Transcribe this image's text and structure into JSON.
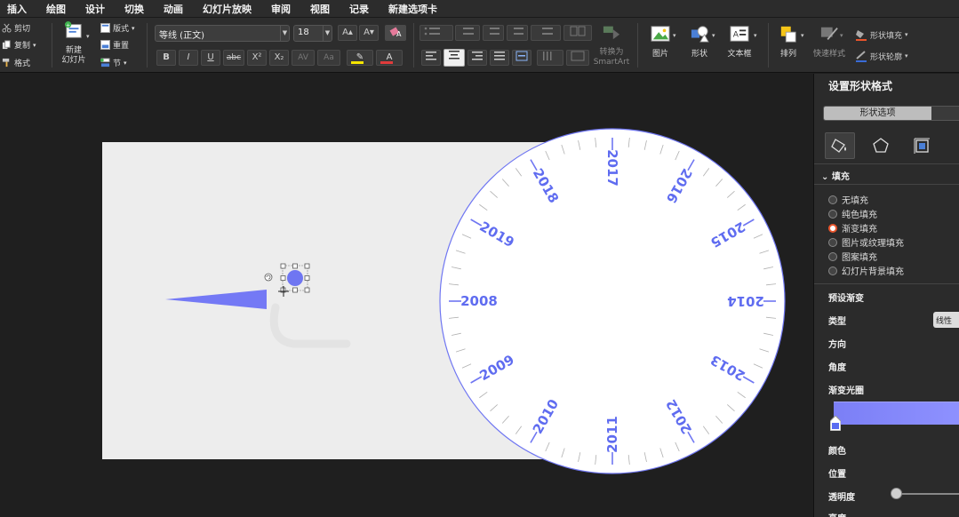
{
  "menubar": {
    "items": [
      "插入",
      "绘图",
      "设计",
      "切换",
      "动画",
      "幻灯片放映",
      "审阅",
      "视图",
      "记录",
      "新建选项卡"
    ]
  },
  "ribbon": {
    "clipboard": {
      "cut": "剪切",
      "copy": "复制",
      "format": "格式"
    },
    "slides": {
      "new_slide": "新建\n幻灯片",
      "layout": "版式",
      "reset": "重置",
      "section": "节"
    },
    "font": {
      "name": "等线 (正文)",
      "size": "18",
      "bold": "B",
      "italic": "I",
      "underline": "U",
      "strike": "abc",
      "superscript": "X²",
      "subscript": "X₂",
      "spacing": "AV",
      "case": "Aa",
      "grow": "A▴",
      "shrink": "A▾",
      "font_color": "A",
      "highlight": "✎"
    },
    "paragraph": {
      "convert_smartart": "转换为\nSmartArt"
    },
    "insert": {
      "picture": "图片",
      "shape": "形状",
      "textbox": "文本框"
    },
    "arrange": {
      "arrange": "排列",
      "quick_styles": "快速样式",
      "shape_fill": "形状填充",
      "shape_outline": "形状轮廓"
    }
  },
  "slide": {
    "dial_years": [
      {
        "label": "2017",
        "angle": 0
      },
      {
        "label": "2016",
        "angle": 30
      },
      {
        "label": "2015",
        "angle": 60
      },
      {
        "label": "2014",
        "angle": 90
      },
      {
        "label": "2013",
        "angle": 120
      },
      {
        "label": "2012",
        "angle": 150
      },
      {
        "label": "2011",
        "angle": 180
      },
      {
        "label": "2010",
        "angle": 210
      },
      {
        "label": "2009",
        "angle": 240
      },
      {
        "label": "2008",
        "angle": 270
      },
      {
        "label": "2019",
        "angle": 300
      },
      {
        "label": "2018",
        "angle": 330
      }
    ],
    "tick_count": 60,
    "accent_color": "#6f76f2",
    "text_color": "#5f6cf0"
  },
  "pane": {
    "title": "设置形状格式",
    "tab_shape_options": "形状选项",
    "section_fill": "填充",
    "fill_options": [
      {
        "label": "无填充",
        "checked": false
      },
      {
        "label": "纯色填充",
        "checked": false
      },
      {
        "label": "渐变填充",
        "checked": true
      },
      {
        "label": "图片或纹理填充",
        "checked": false
      },
      {
        "label": "图案填充",
        "checked": false
      },
      {
        "label": "幻灯片背景填充",
        "checked": false
      }
    ],
    "preset_gradient": "预设渐变",
    "type_label": "类型",
    "type_value": "线性",
    "direction_label": "方向",
    "angle_label": "角度",
    "gradient_stops_label": "渐变光圈",
    "color_label": "颜色",
    "position_label": "位置",
    "transparency_label": "透明度",
    "brightness_label": "亮度",
    "gradient_color": "#7b7ff6"
  }
}
